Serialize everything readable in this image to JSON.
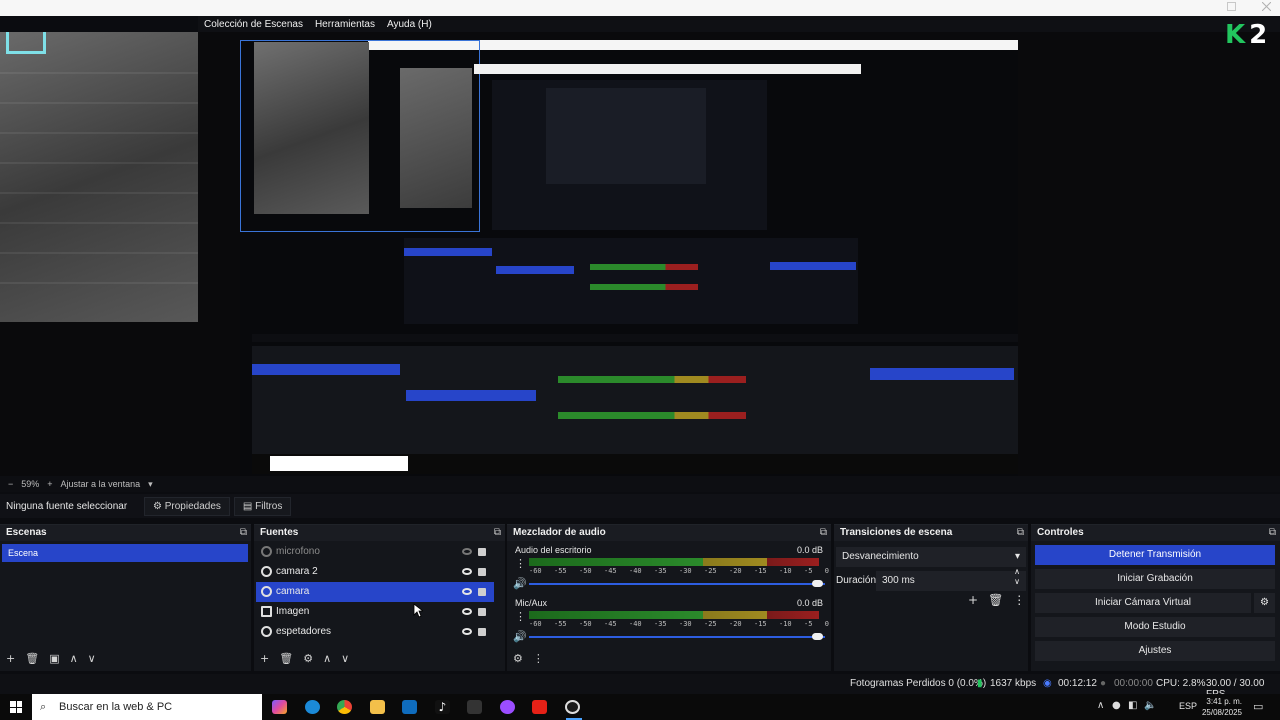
{
  "menubar": {
    "items": [
      "Colección de Escenas",
      "Herramientas",
      "Ayuda (H)"
    ]
  },
  "preview": {
    "badge_number": "2",
    "nested_menu": [
      "Colección de Escenas",
      "Herramientas",
      "Ayuda (H)"
    ]
  },
  "zoombar": {
    "zoom": "59%",
    "fit_label": "Ajustar a la ventana"
  },
  "props": {
    "no_source": "Ninguna fuente seleccionar",
    "properties": "Propiedades",
    "filters": "Filtros"
  },
  "scenes": {
    "title": "Escenas",
    "items": [
      "Escena"
    ]
  },
  "sources": {
    "title": "Fuentes",
    "items": [
      {
        "label": "microfono",
        "icon": "mic-icon",
        "hidden": true
      },
      {
        "label": "camara 2",
        "icon": "camera-icon",
        "hidden": false
      },
      {
        "label": "camara",
        "icon": "camera-icon",
        "hidden": false,
        "selected": true
      },
      {
        "label": "Imagen",
        "icon": "image-icon",
        "hidden": false
      },
      {
        "label": "espetadores",
        "icon": "globe-icon",
        "hidden": false
      }
    ]
  },
  "mixer": {
    "title": "Mezclador de audio",
    "channels": [
      {
        "name": "Audio del escritorio",
        "db": "0.0 dB"
      },
      {
        "name": "Mic/Aux",
        "db": "0.0 dB"
      }
    ],
    "ticks": [
      "-60",
      "-55",
      "-50",
      "-45",
      "-40",
      "-35",
      "-30",
      "-25",
      "-20",
      "-15",
      "-10",
      "-5",
      "0"
    ]
  },
  "transitions": {
    "title": "Transiciones de escena",
    "selected": "Desvanecimiento",
    "duration_label": "Duración",
    "duration_value": "300 ms"
  },
  "controls": {
    "title": "Controles",
    "buttons": [
      "Detener Transmisión",
      "Iniciar Grabación",
      "Iniciar Cámara Virtual",
      "Modo Estudio",
      "Ajustes"
    ]
  },
  "status": {
    "dropped": "Fotogramas Perdidos 0 (0.0%)",
    "bitrate": "1637 kbps",
    "live_time": "00:12:12",
    "rec_time": "00:00:00",
    "cpu": "CPU: 2.8%",
    "fps": "30.00 / 30.00 FPS"
  },
  "taskbar": {
    "search_placeholder": "Buscar en la web & PC",
    "lang": "ESP",
    "time": "3:41 p. m.",
    "date": "25/08/2025"
  },
  "colors": {
    "accent": "#2745c9",
    "logo_green": "#22c55e"
  }
}
